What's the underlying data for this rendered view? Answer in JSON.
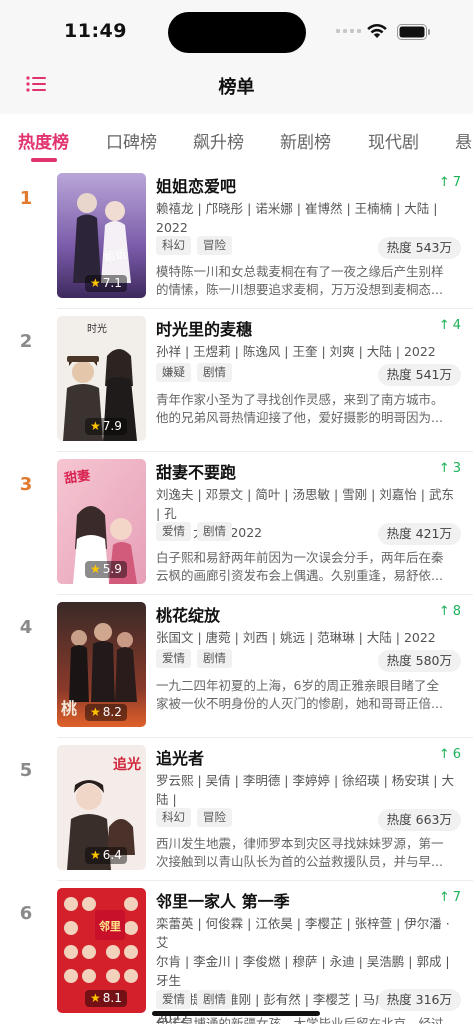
{
  "status_bar": {
    "time": "11:49"
  },
  "nav": {
    "title": "榜单"
  },
  "tabs": [
    {
      "label": "热度榜",
      "active": true
    },
    {
      "label": "口碑榜",
      "active": false
    },
    {
      "label": "飙升榜",
      "active": false
    },
    {
      "label": "新剧榜",
      "active": false
    },
    {
      "label": "现代剧",
      "active": false
    },
    {
      "label": "悬",
      "active": false
    }
  ],
  "accent_color": "#e0336f",
  "trend_color": "#1db25a",
  "items": [
    {
      "rank": "1",
      "title": "姐姐恋爱吧",
      "rating": "7.1",
      "trend": "7",
      "cast_lines": [
        "赖禧龙 | 邝晓彤 | 诺米娜 | 崔博然 | 王楠楠 | 大陆 |",
        "2022"
      ],
      "tags": [
        "科幻",
        "冒险"
      ],
      "heat": "热度 543万",
      "desc_lines": [
        "模特陈一川和女总裁麦桐在有了一夜之缘后产生别样",
        "的情愫，陈一川想要追求麦桐，万万没想到麦桐态..."
      ]
    },
    {
      "rank": "2",
      "title": "时光里的麦穗",
      "rating": "7.9",
      "trend": "4",
      "cast_lines": [
        "孙祥 | 王煜莉 | 陈逸风 | 王奎 | 刘爽 | 大陆 | 2022"
      ],
      "tags": [
        "嫌疑",
        "剧情"
      ],
      "heat": "热度 541万",
      "desc_lines": [
        "青年作家小圣为了寻找创作灵感，来到了南方城市。",
        "他的兄弟风哥热情迎接了他，爱好摄影的明哥因为..."
      ]
    },
    {
      "rank": "3",
      "title": "甜妻不要跑",
      "rating": "5.9",
      "trend": "3",
      "cast_lines": [
        "刘逸夫 | 邓景文 | 简叶 | 汤思敏 | 雪刚 | 刘嘉怡 | 武东 | 孔",
        "令辉 | 大陆 | 2022"
      ],
      "tags": [
        "爱情",
        "剧情"
      ],
      "heat": "热度 421万",
      "desc_lines": [
        "白子熙和易舒两年前因为一次误会分手，两年后在秦",
        "云枫的画廊引资发布会上偶遇。久别重逢，易舒依..."
      ]
    },
    {
      "rank": "4",
      "title": "桃花绽放",
      "rating": "8.2",
      "trend": "8",
      "cast_lines": [
        "张国文 | 唐菀 | 刘西 | 姚远 | 范琳琳 | 大陆 | 2022"
      ],
      "tags": [
        "爱情",
        "剧情"
      ],
      "heat": "热度 580万",
      "desc_lines": [
        "一九二四年初夏的上海，6岁的周正雅亲眼目睹了全",
        "家被一伙不明身份的人灭门的惨剧，她和哥哥正倍..."
      ]
    },
    {
      "rank": "5",
      "title": "追光者",
      "rating": "6.4",
      "trend": "6",
      "cast_lines": [
        "罗云熙 | 吴倩 | 李明德 | 李婷婷 | 徐绍瑛 | 杨安琪 | 大陆 |",
        "2022"
      ],
      "tags": [
        "科幻",
        "冒险"
      ],
      "heat": "热度 663万",
      "desc_lines": [
        "西川发生地震，律师罗本到灾区寻找妹妹罗源，第一",
        "次接触到以青山队长为首的公益救援队员，并与早..."
      ]
    },
    {
      "rank": "6",
      "title": "邻里一家人 第一季",
      "rating": "8.1",
      "trend": "7",
      "cast_lines": [
        "栾蕾英 | 何俊霖 | 江依昊 | 李樱芷 | 张梓萱 | 伊尔潘 · 艾",
        "尔肯 | 李金川 | 李俊燃 | 穆萨 | 永迪 | 吴浩鹏 | 郭成 | 牙生",
        "· 买买提 | 于维刚 | 彭有然 | 李樱芝 | 马成龙 | 大陆 |",
        "2022"
      ],
      "tags": [
        "爱情",
        "剧情"
      ],
      "heat": "热度 316万",
      "desc_lines": [
        "伊诺早博通的新疆女孩，大学毕业后留在北京，经过"
      ]
    }
  ]
}
